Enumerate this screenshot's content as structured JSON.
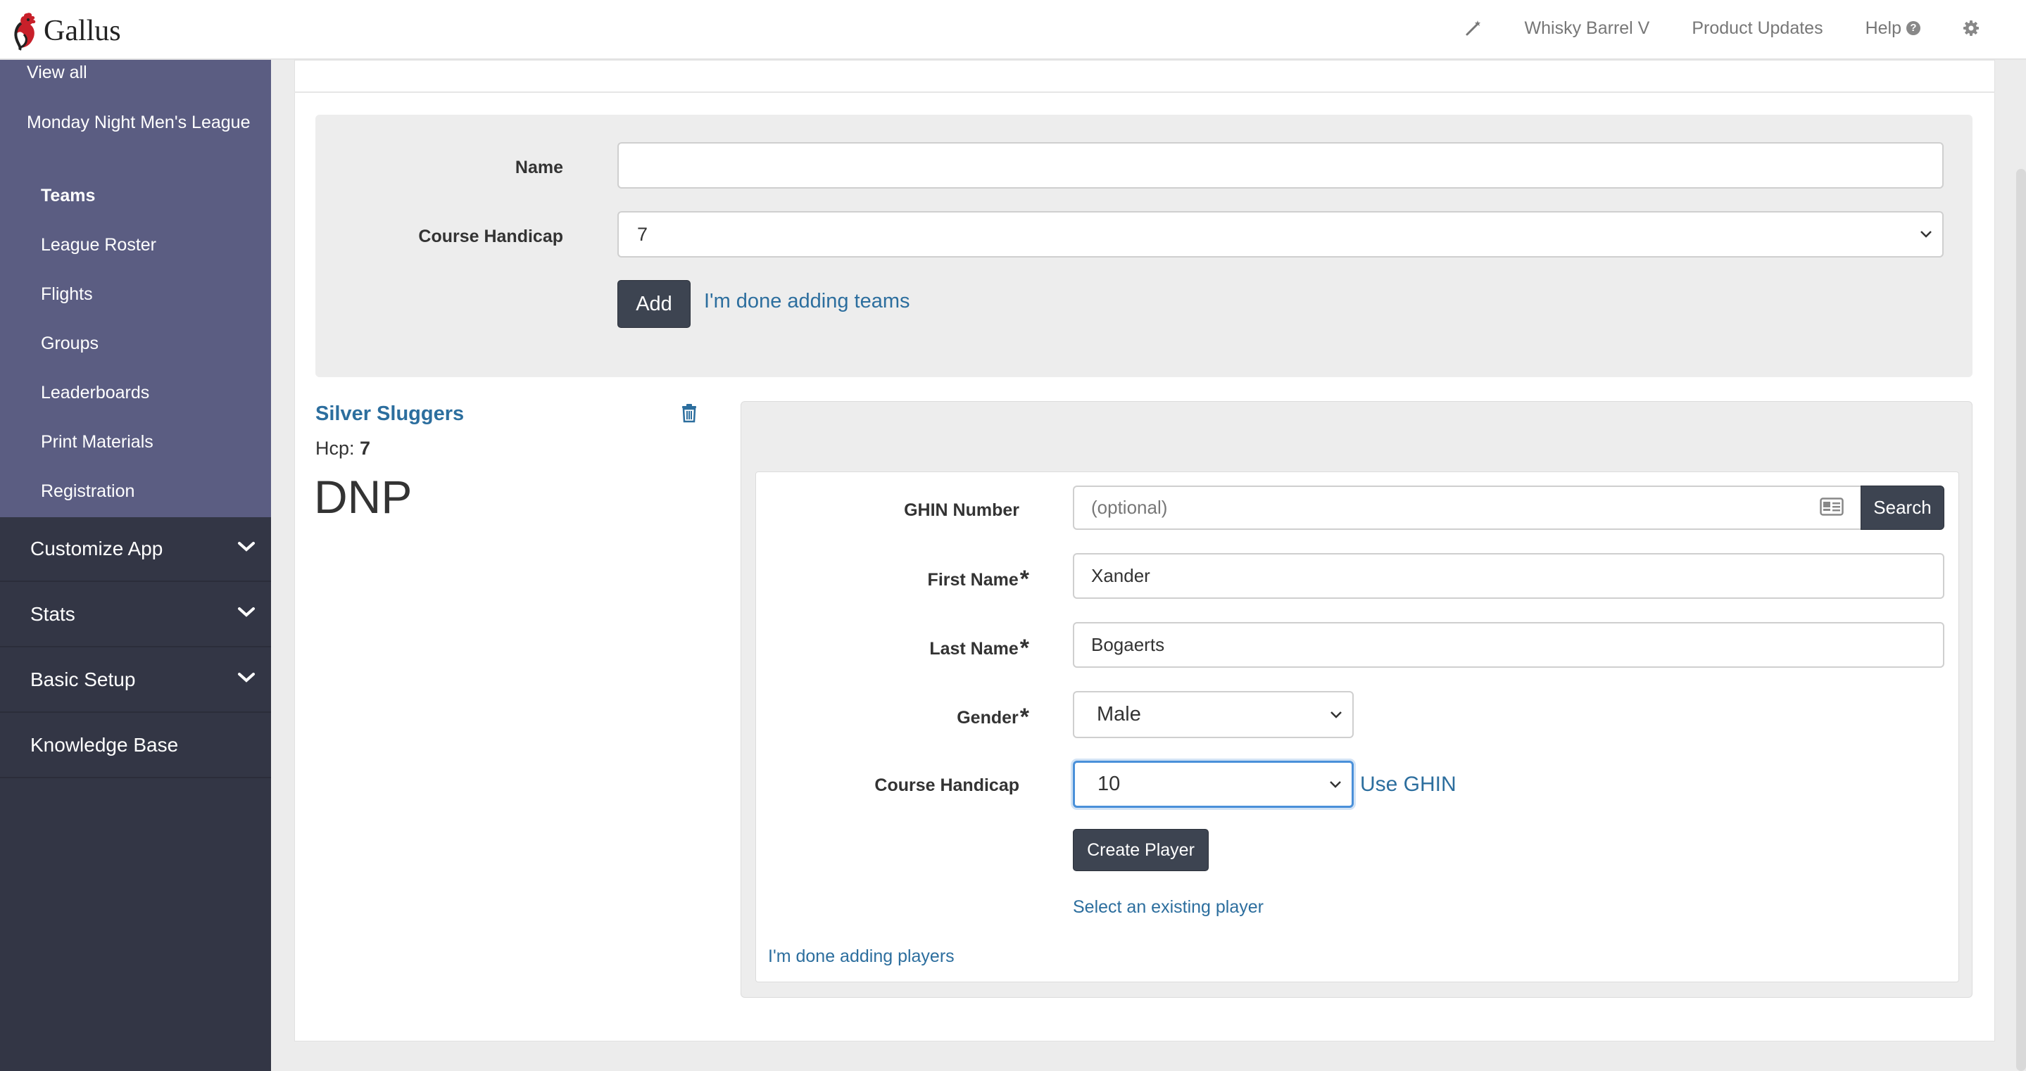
{
  "app": {
    "brand_name": "Gallus"
  },
  "topnav": {
    "icons": {
      "magic": "magic-wand-icon",
      "settings": "gear-icon",
      "help": "question-circle-icon"
    },
    "items": [
      {
        "label": "Whisky Barrel V"
      },
      {
        "label": "Product Updates"
      },
      {
        "label": "Help"
      }
    ]
  },
  "sidebar": {
    "view_all": "View all",
    "league_name": "Monday Night Men's League",
    "items": [
      {
        "label": "Teams",
        "active": true
      },
      {
        "label": "League Roster"
      },
      {
        "label": "Flights"
      },
      {
        "label": "Groups"
      },
      {
        "label": "Leaderboards"
      },
      {
        "label": "Print Materials"
      },
      {
        "label": "Registration"
      }
    ],
    "sections": [
      {
        "label": "Customize App",
        "icon": "chevron-down-icon"
      },
      {
        "label": "Stats",
        "icon": "chevron-down-icon"
      },
      {
        "label": "Basic Setup",
        "icon": "chevron-down-icon"
      },
      {
        "label": "Knowledge Base"
      }
    ]
  },
  "team_form": {
    "name_label": "Name",
    "name_value": "",
    "handicap_label": "Course Handicap",
    "handicap_value": "7",
    "add_label": "Add",
    "done_label": "I'm done adding teams"
  },
  "team": {
    "name": "Silver Sluggers",
    "hcp_label": "Hcp:",
    "hcp_value": "7",
    "status": "DNP",
    "delete_icon": "trash-icon"
  },
  "player_form": {
    "ghin_label": "GHIN Number",
    "ghin_placeholder": "(optional)",
    "ghin_icon": "id-card-icon",
    "search_label": "Search",
    "first_label": "First Name",
    "first_value": "Xander",
    "last_label": "Last Name",
    "last_value": "Bogaerts",
    "gender_label": "Gender",
    "gender_value": "Male",
    "handicap_label": "Course Handicap",
    "handicap_value": "10",
    "use_ghin_label": "Use GHIN",
    "create_label": "Create Player",
    "select_existing_label": "Select an existing player",
    "done_label": "I'm done adding players",
    "required_mark": "*"
  },
  "colors": {
    "sidebar_dark": "#333645",
    "sidebar_sub": "#5b5d82",
    "button_dark": "#3d4451",
    "link_blue": "#2c6e9e",
    "focus_blue": "#4a90d9"
  }
}
